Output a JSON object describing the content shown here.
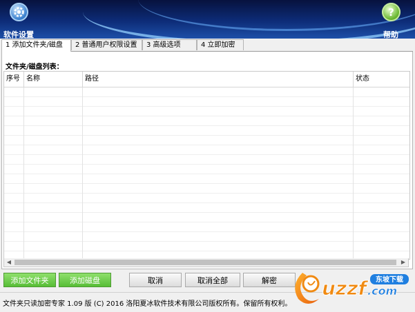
{
  "header": {
    "settings_label": "软件设置",
    "help_label": "帮助",
    "settings_icon": "gear-icon",
    "help_icon": "question-icon"
  },
  "tabs": [
    {
      "label": "1 添加文件夹/磁盘",
      "active": true
    },
    {
      "label": "2 普通用户权限设置",
      "active": false
    },
    {
      "label": "3 高级选项",
      "active": false
    },
    {
      "label": "4 立即加密",
      "active": false
    }
  ],
  "list": {
    "title": "文件夹/磁盘列表：",
    "columns": [
      "序号",
      "名称",
      "路径",
      "状态"
    ],
    "rows": []
  },
  "buttons": {
    "add_folder": "添加文件夹",
    "add_disk": "添加磁盘",
    "cancel": "取消",
    "cancel_all": "取消全部",
    "decrypt": "解密"
  },
  "footer": {
    "text": "文件夹只读加密专家 1.09 版 (C) 2016 洛阳夏冰软件技术有限公司版权所有。保留所有权利。"
  },
  "watermark": {
    "brand": "uzzf.com",
    "tag": "东坡下载"
  },
  "colors": {
    "header_dark": "#07123e",
    "header_light": "#1d4fa8",
    "accent_green": "#57bd36",
    "watermark_orange": "#f08a12",
    "watermark_blue": "#1f7fe0"
  }
}
